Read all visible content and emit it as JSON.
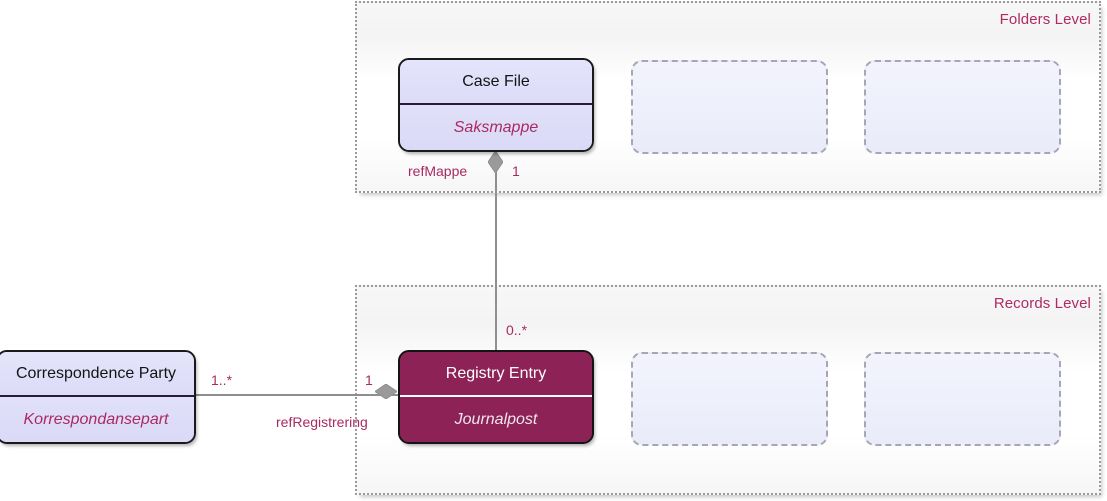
{
  "diagram": {
    "type": "uml-class-diagram",
    "levels": [
      {
        "id": "folders",
        "label": "Folders Level"
      },
      {
        "id": "records",
        "label": "Records Level"
      }
    ],
    "classes": [
      {
        "id": "case-file",
        "name": "Case File",
        "norwegian_name": "Saksmappe",
        "style": "light",
        "level": "folders"
      },
      {
        "id": "registry-entry",
        "name": "Registry Entry",
        "norwegian_name": "Journalpost",
        "style": "dark",
        "level": "records"
      },
      {
        "id": "correspondence-party",
        "name": "Correspondence Party",
        "norwegian_name": "Korrespondansepart",
        "style": "light",
        "level": "none"
      }
    ],
    "associations": [
      {
        "id": "ref-mappe",
        "role": "refMappe",
        "source_multiplicity": "1",
        "target_multiplicity": "0..*",
        "from": "Case File",
        "to": "Registry Entry",
        "kind": "aggregation"
      },
      {
        "id": "ref-registrering",
        "role": "refRegistrering",
        "source_multiplicity": "1",
        "target_multiplicity": "1..*",
        "from": "Registry Entry",
        "to": "Correspondence Party",
        "kind": "aggregation"
      }
    ],
    "placeholders": [
      {
        "id": "folders-placeholder-1",
        "level": "folders"
      },
      {
        "id": "folders-placeholder-2",
        "level": "folders"
      },
      {
        "id": "records-placeholder-1",
        "level": "records"
      },
      {
        "id": "records-placeholder-2",
        "level": "records"
      }
    ]
  },
  "colors": {
    "accent_magenta": "#a82a62",
    "class_dark_fill": "#8d2257",
    "class_light_fill": "#dedefa",
    "connector_grey": "#8f8f8f",
    "container_border": "#9a9a9a",
    "placeholder_border": "#a6a6b4"
  }
}
